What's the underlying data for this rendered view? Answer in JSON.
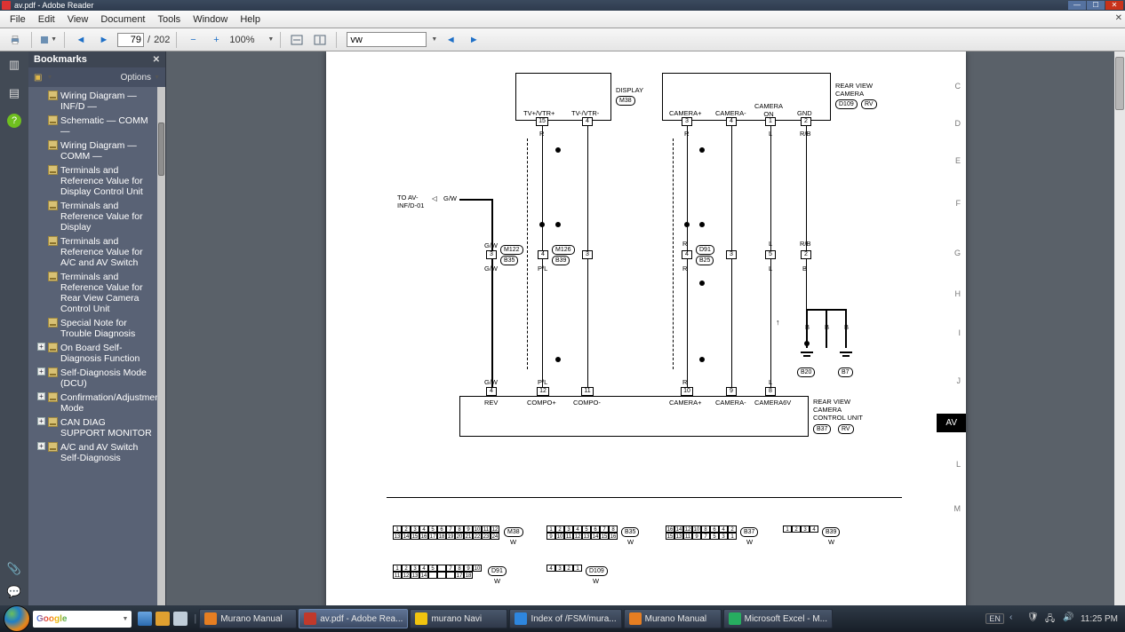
{
  "titlebar": {
    "title": "av.pdf - Adobe Reader"
  },
  "menubar": {
    "items": [
      "File",
      "Edit",
      "View",
      "Document",
      "Tools",
      "Window",
      "Help"
    ]
  },
  "toolbar": {
    "page_current": "79",
    "page_total": "202",
    "page_sep": "/",
    "zoom": "100%",
    "search_value": "vw"
  },
  "bookmarks": {
    "title": "Bookmarks",
    "options_label": "Options",
    "items": [
      {
        "expand": "",
        "label": "Wiring Diagram — INF/D —"
      },
      {
        "expand": "",
        "label": "Schematic — COMM —"
      },
      {
        "expand": "",
        "label": "Wiring Diagram — COMM —"
      },
      {
        "expand": "",
        "label": "Terminals and Reference Value for Display Control Unit"
      },
      {
        "expand": "",
        "label": "Terminals and Reference Value for Display"
      },
      {
        "expand": "",
        "label": "Terminals and Reference Value for A/C and AV Switch"
      },
      {
        "expand": "",
        "label": "Terminals and Reference Value for Rear View Camera Control Unit"
      },
      {
        "expand": "",
        "label": "Special Note for Trouble Diagnosis"
      },
      {
        "expand": "+",
        "label": "On Board Self-Diagnosis Function"
      },
      {
        "expand": "+",
        "label": "Self-Diagnosis Mode (DCU)"
      },
      {
        "expand": "+",
        "label": "Confirmation/Adjustment Mode"
      },
      {
        "expand": "+",
        "label": "CAN DIAG SUPPORT MONITOR"
      },
      {
        "expand": "+",
        "label": "A/C and AV Switch Self-Diagnosis"
      }
    ]
  },
  "schematic": {
    "display_label": "DISPLAY",
    "display_conn": "M38",
    "rearview_label_top": "REAR VIEW\nCAMERA",
    "rearview_conn_top_a": "D109",
    "rearview_conn_top_b": "RV",
    "rearview_label_bot": "REAR VIEW\nCAMERA\nCONTROL UNIT",
    "rearview_conn_bot_a": "B37",
    "rearview_conn_bot_b": "RV",
    "to_av": "TO AV-\nINF/D-01",
    "av_tab": "AV",
    "top_pins": {
      "tv_plus": "TV+/VTR+",
      "tv_plus_num": "15",
      "tv_minus": "TV-/VTR-",
      "tv_minus_num": "4",
      "camera_plus": "CAMERA+",
      "camera_plus_num": "3",
      "camera_minus": "CAMERA-",
      "camera_minus_num": "4",
      "camera_on": "CAMERA\nON",
      "camera_on_num": "1",
      "gnd": "GND",
      "gnd_num": "2"
    },
    "bot_pins": {
      "rev": "REV",
      "rev_num": "4",
      "compo_plus": "COMPO+",
      "compo_plus_num": "12",
      "compo_minus": "COMPO-",
      "compo_minus_num": "11",
      "camera_plus": "CAMERA+",
      "camera_plus_num": "10",
      "camera_minus": "CAMERA-",
      "camera_minus_num": "9",
      "camera6v": "CAMERA6V",
      "camera6v_num": "8"
    },
    "wire_colors": {
      "gw": "G/W",
      "r": "R",
      "pl": "P/L",
      "l": "L",
      "rb": "R/B",
      "b": "B"
    },
    "mid_conns": {
      "m122": "M122",
      "b35": "B35",
      "m126": "M126",
      "b39": "B39",
      "d91": "D91",
      "b25": "B25",
      "b20": "B20",
      "b7": "B7"
    },
    "mid_pins": {
      "p3": "3",
      "p4": "4",
      "p5": "5",
      "p2": "2"
    },
    "grid_letters": [
      "C",
      "D",
      "E",
      "F",
      "G",
      "H",
      "I",
      "J",
      "L",
      "M"
    ],
    "connectors": {
      "m38_top": [
        "1",
        "2",
        "3",
        "4",
        "5",
        "6",
        "7",
        "8",
        "9",
        "10",
        "11",
        "12"
      ],
      "m38_bot": [
        "13",
        "14",
        "15",
        "16",
        "17",
        "18",
        "19",
        "20",
        "21",
        "22",
        "23",
        "24"
      ],
      "m38_label": "M38",
      "m38_sub": "W",
      "b35_top": [
        "1",
        "2",
        "3",
        "4",
        "5",
        "6",
        "7",
        "8"
      ],
      "b35_bot": [
        "9",
        "10",
        "11",
        "12",
        "13",
        "14",
        "15",
        "16"
      ],
      "b35_label": "B35",
      "b35_sub": "W",
      "b37_top": [
        "16",
        "14",
        "12",
        "10",
        "8",
        "6",
        "4",
        "2"
      ],
      "b37_bot": [
        "15",
        "13",
        "11",
        "9",
        "7",
        "5",
        "3",
        "1"
      ],
      "b37_label": "B37",
      "b37_sub": "W",
      "b39_top": [
        "1",
        "2",
        "3",
        "4"
      ],
      "b39_label": "B39",
      "b39_sub": "W",
      "d91_top": [
        "1",
        "2",
        "3",
        "4",
        "5",
        "",
        "7",
        "8",
        "9",
        "10"
      ],
      "d91_bot": [
        "11",
        "12",
        "13",
        "14",
        "",
        "",
        "",
        "17",
        "18"
      ],
      "d91_label": "D91",
      "d91_sub": "W",
      "d109_top": [
        "4",
        "3",
        "2",
        "1"
      ],
      "d109_label": "D109",
      "d109_sub": "W"
    }
  },
  "taskbar": {
    "google_logo": "Google",
    "items": [
      {
        "label": "Murano Manual",
        "icon": "#e67e22",
        "active": false
      },
      {
        "label": "av.pdf - Adobe Rea...",
        "icon": "#c0392b",
        "active": true
      },
      {
        "label": "murano Navi",
        "icon": "#f1c40f",
        "active": false
      },
      {
        "label": "Index of /FSM/mura...",
        "icon": "#2e86de",
        "active": false
      },
      {
        "label": "Murano Manual",
        "icon": "#e67e22",
        "active": false
      },
      {
        "label": "Microsoft Excel - M...",
        "icon": "#27ae60",
        "active": false
      }
    ],
    "lang": "EN",
    "time": "11:25 PM"
  }
}
